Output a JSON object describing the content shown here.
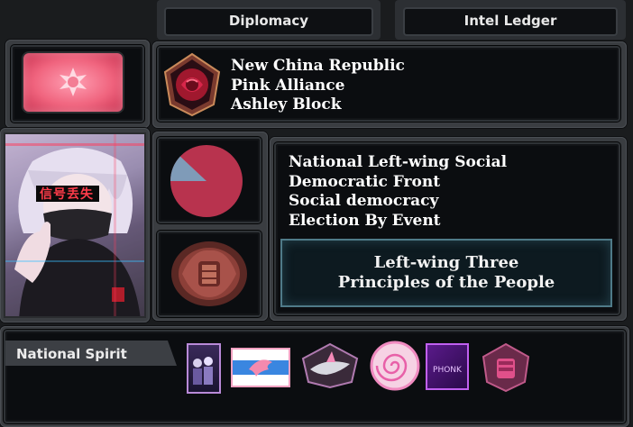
{
  "tabs": [
    {
      "label": "Diplomacy"
    },
    {
      "label": "Intel Ledger"
    }
  ],
  "country": {
    "name": "New China Republic",
    "faction": "Pink Alliance",
    "leader": "Ashley Block"
  },
  "party": {
    "name_line1": "National Left-wing Social",
    "name_line2": "Democratic Front",
    "ideology": "Social democracy",
    "election": "Election By Event"
  },
  "ideology_group": {
    "line1": "Left-wing Three",
    "line2": "Principles of the People"
  },
  "portrait": {
    "banner_text": "信号丢失"
  },
  "national_spirit": {
    "title": "National Spirit",
    "icons": [
      "anime-group-icon",
      "dove-banner-icon",
      "shark-emblem-icon",
      "pink-spiral-icon",
      "phonk-icon",
      "fist-emblem-icon"
    ]
  },
  "colors": {
    "accent_pink": "#e23a6a",
    "pie_main": "#b8334e",
    "pie_minor": "#7f9bb8",
    "ideology_border": "#4f7a88"
  },
  "popularity": {
    "main_share": 0.88,
    "minor_share": 0.12
  }
}
